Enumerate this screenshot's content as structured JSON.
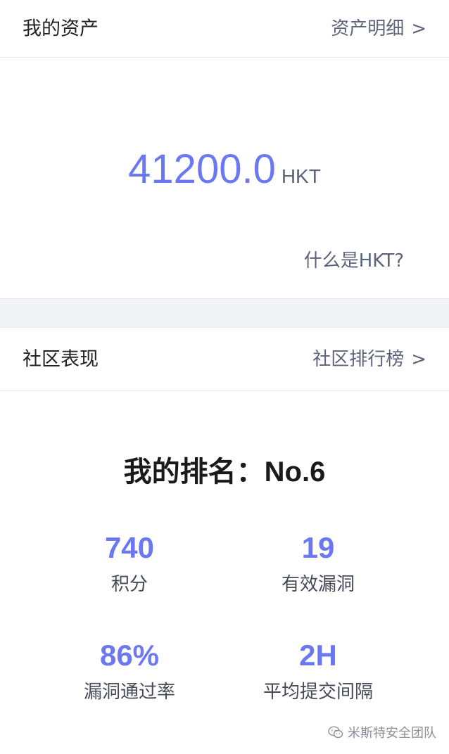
{
  "assets": {
    "title": "我的资产",
    "detail_link": "资产明细",
    "chevron": ">",
    "balance_value": "41200.0",
    "balance_unit": "HKT",
    "what_is_link": "什么是HKT?"
  },
  "community": {
    "title": "社区表现",
    "ranking_link": "社区排行榜",
    "chevron": ">",
    "rank_label": "我的排名：",
    "rank_value": "No.6",
    "stats": [
      {
        "value": "740",
        "label": "积分"
      },
      {
        "value": "19",
        "label": "有效漏洞"
      },
      {
        "value": "86%",
        "label": "漏洞通过率"
      },
      {
        "value": "2H",
        "label": "平均提交间隔"
      }
    ]
  },
  "watermark": {
    "text": "米斯特安全团队",
    "icon": "wechat-icon"
  },
  "colors": {
    "accent": "#6b78f2",
    "muted_text": "#5b6478",
    "divider_band": "#f2f3f7"
  }
}
